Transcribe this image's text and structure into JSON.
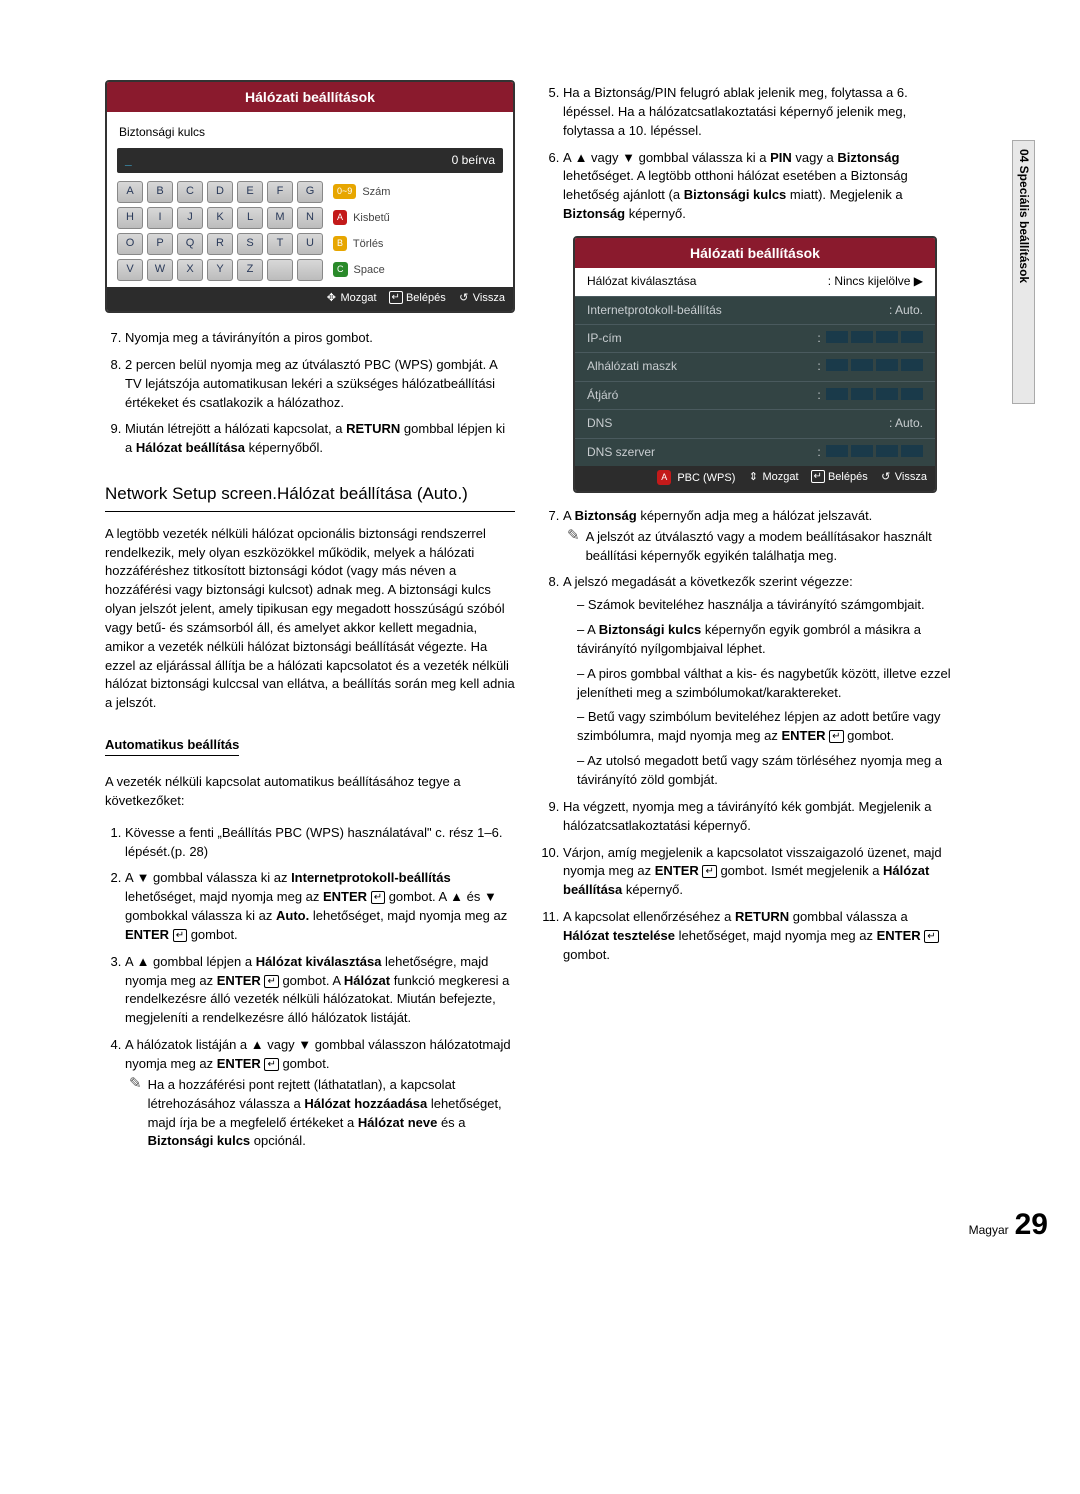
{
  "sidebar_label": "04  Speciális beállítások",
  "keyboard_panel": {
    "title": "Hálózati beállítások",
    "subtitle": "Biztonsági kulcs",
    "entered_suffix": "0 beírva",
    "rows": [
      {
        "keys": [
          "A",
          "B",
          "C",
          "D",
          "E",
          "F",
          "G"
        ],
        "label": "Szám",
        "pill": "0~9"
      },
      {
        "keys": [
          "H",
          "I",
          "J",
          "K",
          "L",
          "M",
          "N"
        ],
        "label": "Kisbetű",
        "pill": "A"
      },
      {
        "keys": [
          "O",
          "P",
          "Q",
          "R",
          "S",
          "T",
          "U"
        ],
        "label": "Törlés",
        "pill": "B"
      },
      {
        "keys": [
          "V",
          "W",
          "X",
          "Y",
          "Z",
          " ",
          " "
        ],
        "label": "Space",
        "pill": "C"
      }
    ],
    "footer": {
      "move": "Mozgat",
      "enter": "Belépés",
      "return": "Vissza"
    }
  },
  "left_steps_a": {
    "s7": "Nyomja meg a távirányítón a piros gombot.",
    "s8": "2 percen belül nyomja meg az útválasztó PBC (WPS) gombját. A TV lejátszója automatikusan lekéri a szükséges hálózatbeállítási értékeket és csatlakozik a hálózathoz.",
    "s9_pre": "Miután létrejött a hálózati kapcsolat, a ",
    "s9_b1": "RETURN",
    "s9_mid": " gombbal lépjen ki a ",
    "s9_b2": "Hálózat beállítása",
    "s9_post": " képernyőből."
  },
  "section_heading": "Network Setup screen.Hálózat beállítása (Auto.)",
  "section_para": "A legtöbb vezeték nélküli hálózat opcionális biztonsági rendszerrel rendelkezik, mely olyan eszközökkel működik, melyek a hálózati hozzáféréshez titkosított biztonsági kódot (vagy más néven a hozzáférési vagy biztonsági kulcsot) adnak meg. A biztonsági kulcs olyan jelszót jelent, amely tipikusan egy megadott hosszúságú szóból vagy betű- és számsorból áll, és amelyet akkor kellett megadnia, amikor a vezeték nélküli hálózat biztonsági beállítását végezte.  Ha ezzel az eljárással állítja be a hálózati kapcsolatot és a vezeték nélküli hálózat biztonsági kulccsal van ellátva, a beállítás során meg kell adnia a jelszót.",
  "auto_heading": "Automatikus beállítás",
  "auto_intro": "A vezeték nélküli kapcsolat automatikus beállításához tegye a következőket:",
  "left_steps_b": {
    "s1": "Kövesse a fenti „Beállítás PBC (WPS) használatával\" c. rész 1–6. lépését.(p. 28)",
    "s2": "A ▼ gombbal válassza ki az Internetprotokoll-beállítás lehetőséget, majd nyomja meg az ENTER [↵] gombot. A ▲ és ▼ gombokkal válassza ki az Auto. lehetőséget, majd nyomja meg az ENTER [↵] gombot.",
    "s3": "A ▲ gombbal lépjen a Hálózat kiválasztása lehetőségre, majd nyomja meg az ENTER [↵] gombot. A Hálózat funkció megkeresi a rendelkezésre álló vezeték nélküli hálózatokat. Miután befejezte, megjeleníti a rendelkezésre álló hálózatok listáját.",
    "s4": "A hálózatok listáján a ▲ vagy ▼ gombbal válasszon hálózatotmajd nyomja meg az ENTER [↵] gombot.",
    "s4_note": "Ha a hozzáférési pont rejtett (láthatatlan), a kapcsolat létrehozásához válassza a Hálózat hozzáadása lehetőséget, majd írja be a megfelelő értékeket a Hálózat neve és a Biztonsági kulcs opciónál."
  },
  "right_steps_a": {
    "s5": "Ha a Biztonság/PIN felugró ablak jelenik meg, folytassa a 6. lépéssel. Ha a hálózatcsatlakoztatási képernyő jelenik meg, folytassa a 10. lépéssel.",
    "s6_pre": "A ▲ vagy ▼ gombbal válassza ki a ",
    "s6_b1": "PIN",
    "s6_mid1": " vagy a ",
    "s6_b2": "Biztonság",
    "s6_mid2": " lehetőséget. A legtöbb otthoni hálózat esetében a Biztonság lehetőség ajánlott (a ",
    "s6_b3": "Biztonsági kulcs",
    "s6_mid3": " miatt). Megjelenik a ",
    "s6_b4": "Biztonság",
    "s6_post": " képernyő."
  },
  "settings_panel": {
    "title": "Hálózati beállítások",
    "rows": [
      {
        "label": "Hálózat kiválasztása",
        "value": ": Nincs kijelölve ▶",
        "type": "text"
      },
      {
        "label": "Internetprotokoll-beállítás",
        "value": ": Auto.",
        "type": "text"
      },
      {
        "label": "IP-cím",
        "value": ":",
        "type": "blocks"
      },
      {
        "label": "Alhálózati maszk",
        "value": ":",
        "type": "blocks"
      },
      {
        "label": "Átjáró",
        "value": ":",
        "type": "blocks"
      },
      {
        "label": "DNS",
        "value": ": Auto.",
        "type": "text"
      },
      {
        "label": "DNS szerver",
        "value": ":",
        "type": "blocks"
      }
    ],
    "footer": {
      "pbc": "PBC (WPS)",
      "move": "Mozgat",
      "enter": "Belépés",
      "return": "Vissza"
    }
  },
  "right_steps_b": {
    "s7_pre": "A ",
    "s7_b": "Biztonság",
    "s7_post": " képernyőn adja meg a hálózat jelszavát.",
    "s7_note": "A jelszót az útválasztó vagy a modem beállításakor használt beállítási képernyők egyikén találhatja meg.",
    "s8": "A jelszó megadását a következők szerint végezze:",
    "s8_items": [
      "Számok beviteléhez használja a távirányító számgombjait.",
      "A Biztonsági kulcs képernyőn egyik gombról a másikra a távirányító nyílgombjaival léphet.",
      "A piros gombbal válthat a kis- és nagybetűk között, illetve ezzel jelenítheti meg a szimbólumokat/karaktereket.",
      "Betű vagy szimbólum beviteléhez lépjen az adott betűre vagy szimbólumra, majd nyomja meg az ENTER [↵] gombot.",
      "Az utolsó megadott betű vagy szám törléséhez nyomja meg a távirányító zöld gombját."
    ],
    "s9": "Ha végzett, nyomja meg a távirányító kék gombját. Megjelenik a hálózatcsatlakoztatási képernyő.",
    "s10": "Várjon, amíg megjelenik a kapcsolatot visszaigazoló üzenet, majd nyomja meg az ENTER [↵] gombot. Ismét megjelenik a Hálózat beállítása képernyő.",
    "s11": "A kapcsolat ellenőrzéséhez a RETURN gombbal válassza a Hálózat tesztelése lehetőséget, majd nyomja meg az ENTER [↵] gombot."
  },
  "page_footer": {
    "lang": "Magyar",
    "num": "29"
  }
}
